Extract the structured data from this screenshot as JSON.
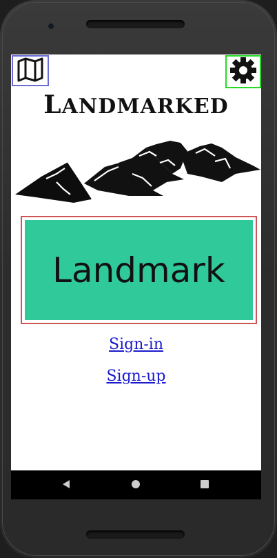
{
  "app": {
    "title": "Landmarked",
    "map_icon": "map-icon",
    "settings_icon": "gear-icon"
  },
  "main": {
    "landmark_button": "Landmark",
    "sign_in": "Sign-in",
    "sign_up": "Sign-up"
  },
  "system_nav": {
    "back_icon": "back-icon",
    "home_icon": "home-icon",
    "recents_icon": "recents-icon"
  },
  "colors": {
    "landmark_button": "#2fc99a",
    "landmark_border": "#cc5555",
    "map_border": "#6b6bd8",
    "settings_border": "#22dd22",
    "link": "#1a1acc"
  }
}
